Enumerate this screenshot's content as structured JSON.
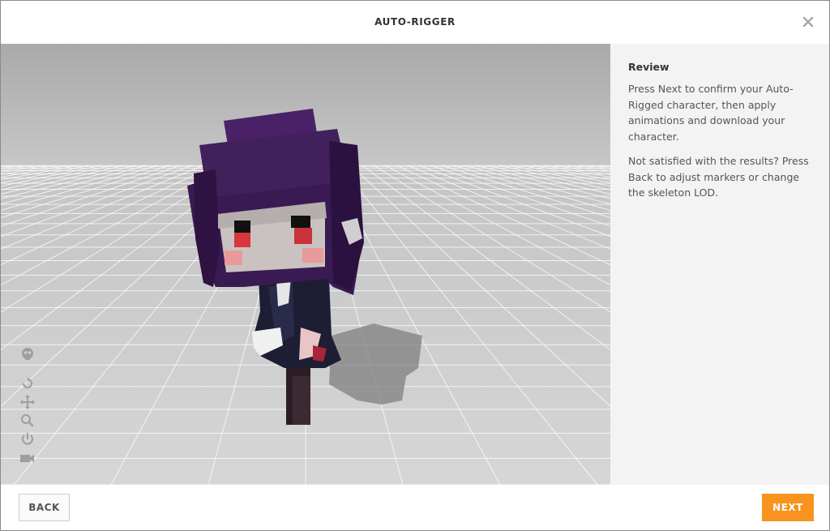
{
  "header": {
    "title": "AUTO-RIGGER",
    "close_icon": "close-icon"
  },
  "viewport": {
    "tools": [
      "skeleton-icon",
      "rotate-icon",
      "move-icon",
      "zoom-icon",
      "power-icon",
      "camera-icon"
    ]
  },
  "panel": {
    "heading": "Review",
    "paragraph1": "Press Next to confirm your Auto-Rigged character, then apply animations and download your character.",
    "paragraph2": "Not satisfied with the results? Press Back to adjust markers or change the skeleton LOD."
  },
  "footer": {
    "back_label": "BACK",
    "next_label": "NEXT"
  },
  "colors": {
    "accent": "#f7931e",
    "hair": "#3a1a52",
    "outfit": "#1f1f3a"
  }
}
